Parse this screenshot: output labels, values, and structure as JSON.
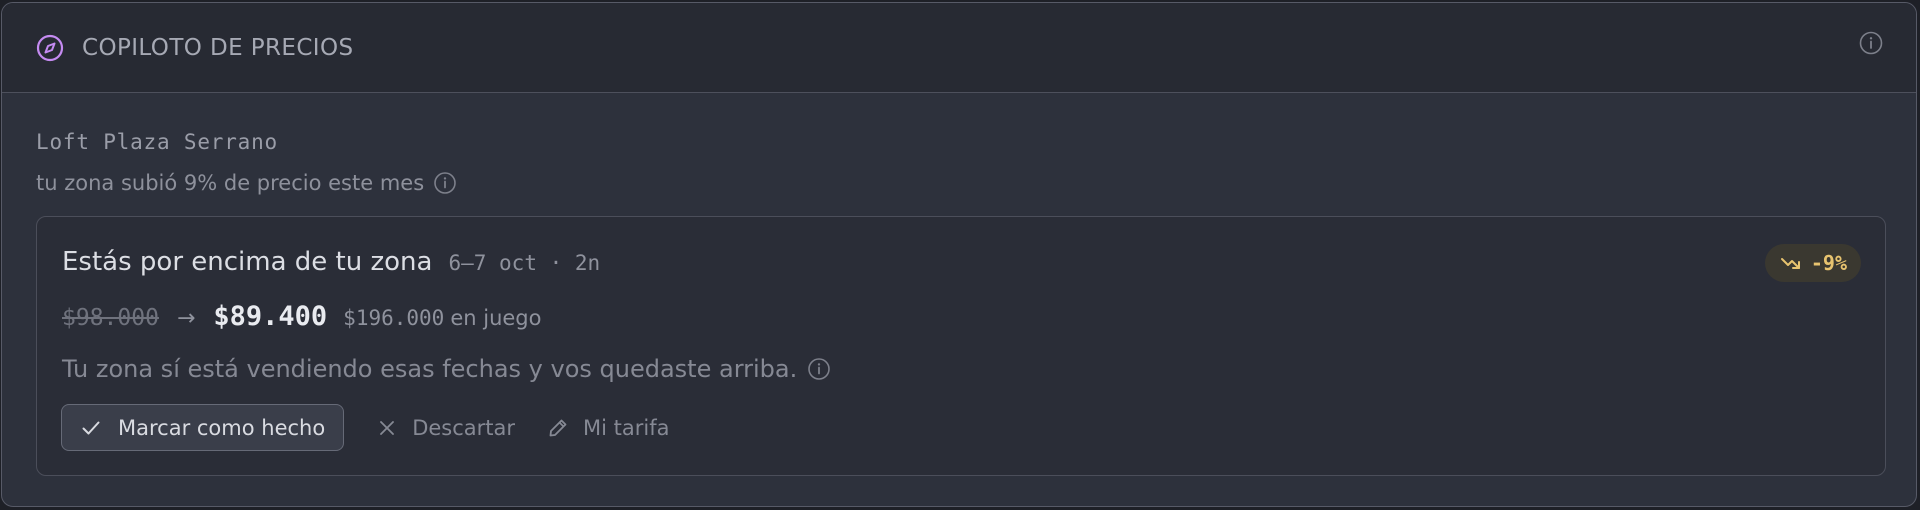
{
  "header": {
    "title": "COPILOTO DE PRECIOS",
    "icon": "compass-icon",
    "info_icon": "info-icon",
    "accent_color": "#c58bf2"
  },
  "property": {
    "name": "Loft Plaza Serrano",
    "zone_note": "tu zona subió 9% de precio este mes"
  },
  "card": {
    "title": "Estás por encima de tu zona",
    "dates": "6–7 oct · 2n",
    "badge": "-9%",
    "badge_color": "#e7c36f",
    "old_price": "$98.000",
    "arrow": "→",
    "new_price": "$89.400",
    "at_stake_amount": "$196.000",
    "at_stake_label": "en juego",
    "message": "Tu zona sí está vendiendo esas fechas y vos quedaste arriba.",
    "actions": {
      "done": "Marcar como hecho",
      "dismiss": "Descartar",
      "my_rate": "Mi tarifa"
    }
  }
}
